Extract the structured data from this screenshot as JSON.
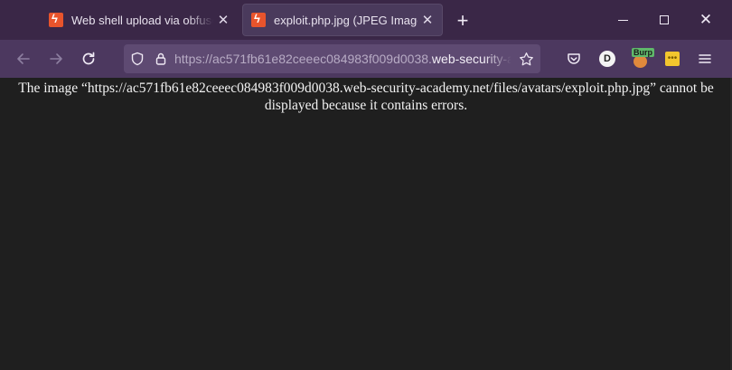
{
  "tabs": [
    {
      "title": "Web shell upload via obfuscated file extension",
      "close": "✕",
      "active": false,
      "icon": "burp-favicon"
    },
    {
      "title": "exploit.php.jpg (JPEG Image)",
      "close": "✕",
      "active": true,
      "icon": "burp-favicon"
    }
  ],
  "new_tab": "+",
  "window_controls": {
    "minimize": "minimize",
    "maximize": "maximize",
    "close": "✕"
  },
  "nav": {
    "back": "back-arrow-icon",
    "forward": "forward-arrow-icon",
    "reload": "reload-icon"
  },
  "urlbar": {
    "prefix": "https://ac571fb61e82ceeec084983f009d0038.",
    "host": "web-security-academy.net/files/avatars/exploit.php.jpg"
  },
  "toolbar": {
    "account_initial": "D",
    "burp_tag": "Burp",
    "menu_icon": "hamburger-menu-icon"
  },
  "content": {
    "message": "The image “https://ac571fb61e82ceeec084983f009d0038.web-security-academy.net/files/avatars/exploit.php.jpg” cannot be displayed because it contains errors."
  },
  "colors": {
    "tabbar": "#3a2747",
    "navbar": "#4c385f",
    "urlbar": "#5e4a72",
    "content_bg": "#1f1f1f",
    "text": "#f2f2f2"
  }
}
